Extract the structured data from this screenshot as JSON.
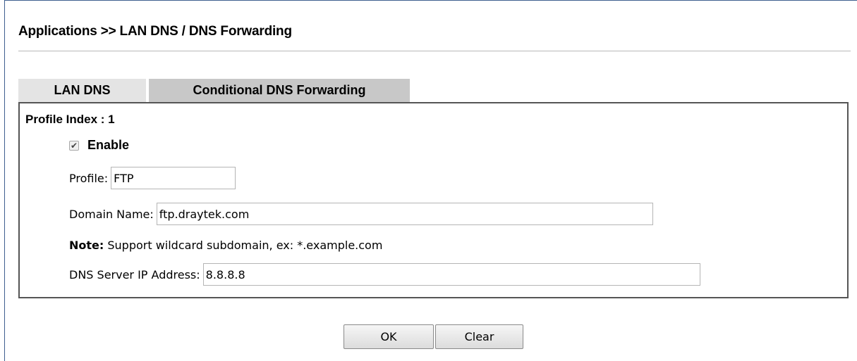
{
  "page": {
    "title": "Applications >> LAN DNS / DNS Forwarding"
  },
  "tabs": [
    {
      "label": "LAN DNS",
      "active": false
    },
    {
      "label": "Conditional DNS Forwarding",
      "active": true
    }
  ],
  "form": {
    "profile_index_label": "Profile Index : 1",
    "enable": {
      "label": "Enable",
      "checked": true
    },
    "profile": {
      "label": "Profile:",
      "value": "FTP"
    },
    "domain_name": {
      "label": "Domain Name:",
      "value": "ftp.draytek.com"
    },
    "note": {
      "prefix": "Note:",
      "text": " Support wildcard subdomain, ex: *.example.com"
    },
    "dns_server_ip": {
      "label": "DNS Server IP Address:",
      "value": "8.8.8.8"
    }
  },
  "buttons": {
    "ok_label": "OK",
    "clear_label": "Clear"
  },
  "colors": {
    "tab_inactive": "#e4e4e4",
    "tab_active": "#c8c8c8",
    "panel_border": "#555555"
  }
}
